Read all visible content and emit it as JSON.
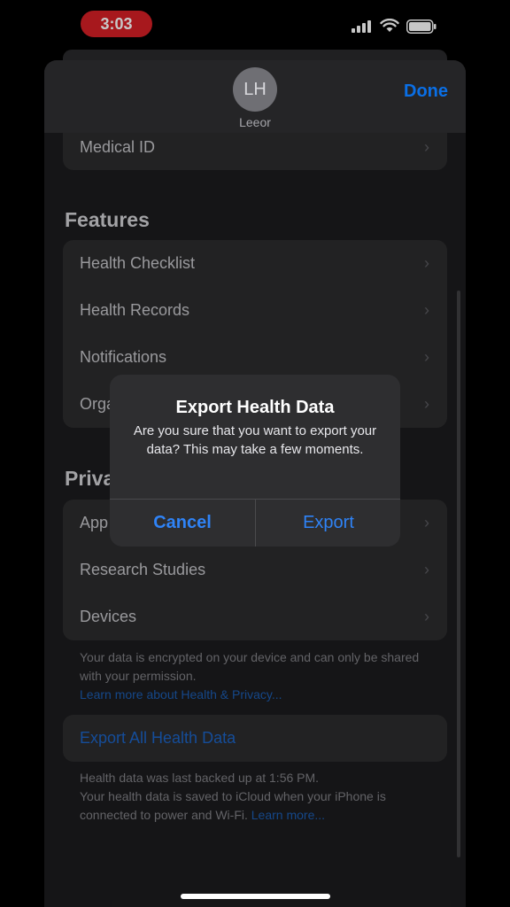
{
  "status_bar": {
    "time": "3:03"
  },
  "header": {
    "avatar_initials": "LH",
    "user_name": "Leeor",
    "done_label": "Done"
  },
  "top_group": {
    "items": [
      {
        "label": "Medical ID"
      }
    ]
  },
  "features": {
    "title": "Features",
    "items": [
      {
        "label": "Health Checklist"
      },
      {
        "label": "Health Records"
      },
      {
        "label": "Notifications"
      },
      {
        "label": "Orga"
      }
    ]
  },
  "privacy": {
    "title": "Priva",
    "items": [
      {
        "label": "App"
      },
      {
        "label": "Research Studies"
      },
      {
        "label": "Devices"
      }
    ],
    "footnote": "Your data is encrypted on your device and can only be shared with your permission.",
    "footnote_link": "Learn more about Health & Privacy..."
  },
  "export": {
    "label": "Export All Health Data",
    "footnote_line1": "Health data was last backed up at 1:56 PM.",
    "footnote_line2": "Your health data is saved to iCloud when your iPhone is connected to power and Wi-Fi.",
    "footnote_link": "Learn more..."
  },
  "alert": {
    "title": "Export Health Data",
    "message": "Are you sure that you want to export your data? This may take a few moments.",
    "cancel_label": "Cancel",
    "export_label": "Export"
  },
  "icons": {
    "chevron": "chevron-right-icon"
  },
  "colors": {
    "accent": "#2f83f6",
    "time_pill": "#d61f26",
    "background": "#1c1c1e"
  }
}
